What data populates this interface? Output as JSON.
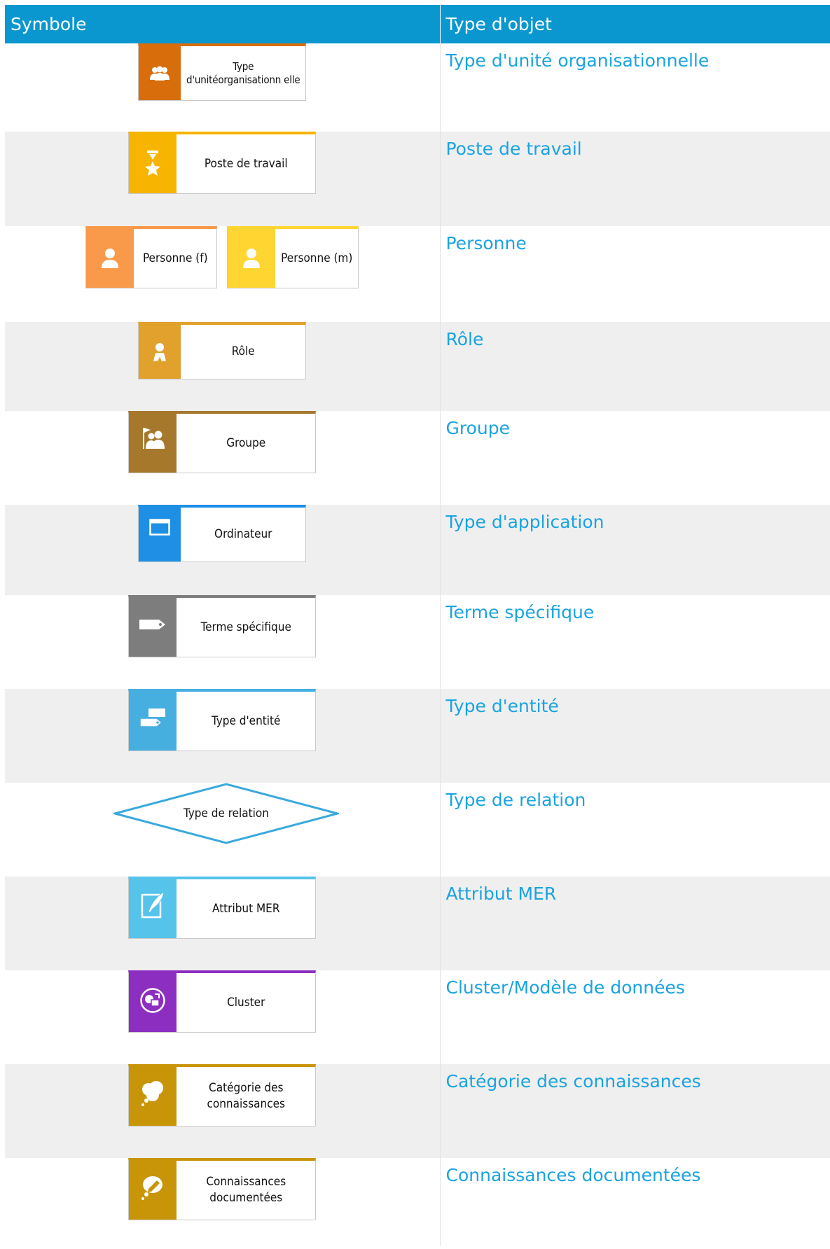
{
  "header": {
    "col_symbol": "Symbole",
    "col_type": "Type d'objet"
  },
  "rows": [
    {
      "symbols": [
        {
          "label": "Type d'unitéorganisationn elle",
          "color": "#d86d0c",
          "icon": "org-unit-icon"
        }
      ],
      "type": "Type d'unité organisationnelle"
    },
    {
      "symbols": [
        {
          "label": "Poste de travail",
          "color": "#f7b400",
          "icon": "position-icon"
        }
      ],
      "type": "Poste de travail"
    },
    {
      "symbols": [
        {
          "label": "Personne (f)",
          "color": "#f99a4a",
          "icon": "person-icon"
        },
        {
          "label": "Personne (m)",
          "color": "#ffd531",
          "icon": "person-icon"
        }
      ],
      "type": "Personne"
    },
    {
      "symbols": [
        {
          "label": "Rôle",
          "color": "#e2a02d",
          "icon": "role-icon"
        }
      ],
      "type": "Rôle"
    },
    {
      "symbols": [
        {
          "label": "Groupe",
          "color": "#a5782c",
          "icon": "group-icon"
        }
      ],
      "type": "Groupe"
    },
    {
      "symbols": [
        {
          "label": "Ordinateur",
          "color": "#1e8fe5",
          "icon": "application-window-icon"
        }
      ],
      "type": "Type d'application"
    },
    {
      "symbols": [
        {
          "label": "Terme spécifique",
          "color": "#7d7d7d",
          "icon": "tag-icon"
        }
      ],
      "type": "Terme spécifique"
    },
    {
      "symbols": [
        {
          "label": "Type d'entité",
          "color": "#47aee0",
          "icon": "entity-icon"
        }
      ],
      "type": "Type d'entité"
    },
    {
      "symbols": [
        {
          "label": "Type de relation",
          "color": "#3aa9dc",
          "icon": "diamond"
        }
      ],
      "type": "Type de relation"
    },
    {
      "symbols": [
        {
          "label": "Attribut MER",
          "color": "#55c3ea",
          "icon": "attribute-icon"
        }
      ],
      "type": "Attribut MER"
    },
    {
      "symbols": [
        {
          "label": "Cluster",
          "color": "#8c2ec0",
          "icon": "cluster-icon"
        }
      ],
      "type": "Cluster/Modèle de données"
    },
    {
      "symbols": [
        {
          "label": "Catégorie des connaissances",
          "color": "#c89408",
          "icon": "knowledge-cloud-icon"
        }
      ],
      "type": "Catégorie des connaissances"
    },
    {
      "symbols": [
        {
          "label": "Connaissances documentées",
          "color": "#c89408",
          "icon": "documented-knowledge-icon"
        }
      ],
      "type": "Connaissances documentées"
    }
  ]
}
